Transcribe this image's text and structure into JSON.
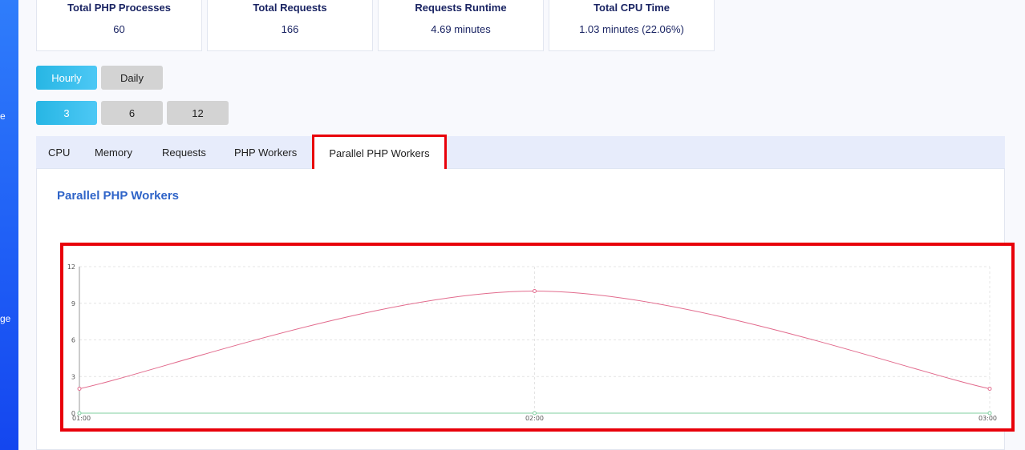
{
  "sidebar": {
    "fragments": [
      "e",
      "ge"
    ]
  },
  "stats": [
    {
      "label": "Total PHP Processes",
      "value": "60"
    },
    {
      "label": "Total Requests",
      "value": "166"
    },
    {
      "label": "Requests Runtime",
      "value": "4.69 minutes"
    },
    {
      "label": "Total CPU Time",
      "value": "1.03 minutes (22.06%)"
    }
  ],
  "period_buttons": [
    {
      "label": "Hourly",
      "active": true
    },
    {
      "label": "Daily",
      "active": false
    }
  ],
  "range_buttons": [
    {
      "label": "3",
      "active": true
    },
    {
      "label": "6",
      "active": false
    },
    {
      "label": "12",
      "active": false
    }
  ],
  "tabs": [
    {
      "label": "CPU"
    },
    {
      "label": "Memory"
    },
    {
      "label": "Requests"
    },
    {
      "label": "PHP Workers"
    },
    {
      "label": "Parallel PHP Workers",
      "active": true
    }
  ],
  "panel": {
    "title": "Parallel PHP Workers"
  },
  "colors": {
    "series_primary": "#e26b8d",
    "series_secondary": "#7fcf9f",
    "highlight_border": "#e8000a"
  },
  "chart_data": {
    "type": "line",
    "x": [
      "01:00",
      "02:00",
      "03:00"
    ],
    "yticks": [
      0,
      3,
      6,
      9,
      12
    ],
    "ylim": [
      0,
      12
    ],
    "grid": true,
    "series": [
      {
        "values": [
          2,
          10,
          2
        ],
        "color": "#e26b8d"
      },
      {
        "values": [
          0,
          0,
          0
        ],
        "color": "#7fcf9f"
      }
    ]
  }
}
